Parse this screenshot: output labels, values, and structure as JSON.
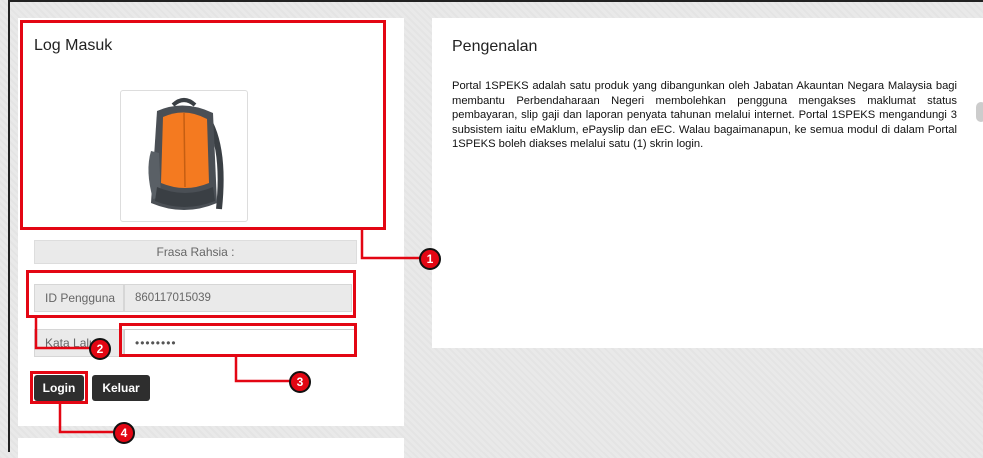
{
  "login": {
    "title": "Log Masuk",
    "phrase_label": "Frasa Rahsia :",
    "user_id_label": "ID Pengguna",
    "user_id_value": "860117015039",
    "password_label": "Kata Laluan",
    "password_value": "••••••••",
    "login_button": "Login",
    "exit_button": "Keluar",
    "image_icon": "backpack-image"
  },
  "intro": {
    "title": "Pengenalan",
    "body": "Portal 1SPEKS adalah satu produk yang dibangunkan oleh Jabatan Akauntan Negara Malaysia bagi membantu Perbendaharaan Negeri membolehkan pengguna mengakses maklumat status pembayaran, slip gaji dan laporan penyata tahunan melalui internet. Portal 1SPEKS mengandungi 3 subsistem iaitu eMaklum, ePayslip dan eEC. Walau bagaimanapun, ke semua modul di dalam Portal 1SPEKS boleh diakses melalui satu (1) skrin login."
  },
  "callouts": [
    "1",
    "2",
    "3",
    "4"
  ],
  "colors": {
    "highlight": "#e30613",
    "button": "#2e2e2e",
    "backpack_orange": "#f47a20",
    "backpack_grey": "#4a4f55"
  }
}
